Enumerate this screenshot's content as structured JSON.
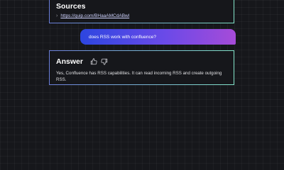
{
  "sources": {
    "title": "Sources",
    "links": [
      "https://quip.com/BHaaAMCdABwl"
    ]
  },
  "user_message": "does RSS work with confluence?",
  "answer": {
    "title": "Answer",
    "text": "Yes, Confluence has RSS capabilities. It can read incoming RSS and create outgoing RSS.",
    "icons": [
      "thumbs-up-icon",
      "thumbs-down-icon"
    ]
  },
  "colors": {
    "background": "#16171b",
    "bubble_gradient_start": "#2d46e0",
    "bubble_gradient_end": "#a64bd8",
    "card_border_start": "#6a7ed9",
    "card_border_end": "#7fe0c6"
  }
}
